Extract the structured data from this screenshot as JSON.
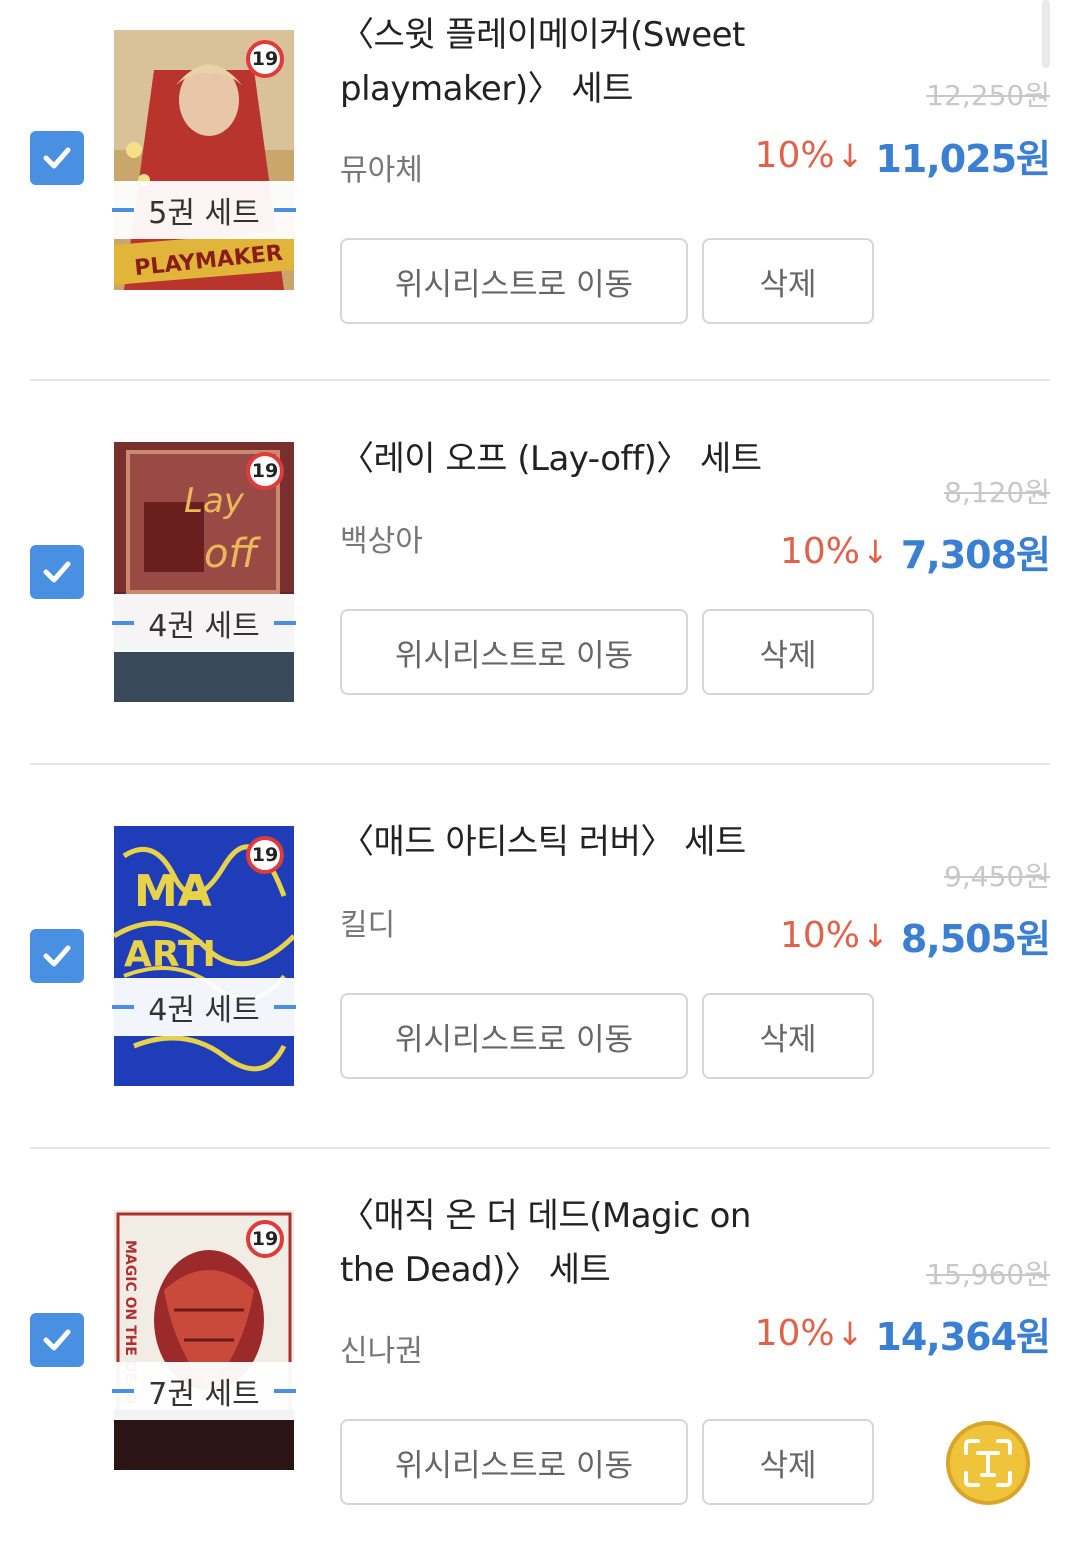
{
  "cart": {
    "items": [
      {
        "title": "〈스윗 플레이메이커(Sweet playmaker)〉 세트",
        "author": "뮤아체",
        "set_count": "5권 세트",
        "age_rating": "19",
        "original_price": "12,250원",
        "discount": "10%",
        "sale_price": "11,025원",
        "checked": true,
        "wishlist_button": "위시리스트로 이동",
        "delete_button": "삭제"
      },
      {
        "title": "〈레이 오프 (Lay-off)〉 세트",
        "author": "백상아",
        "set_count": "4권 세트",
        "age_rating": "19",
        "original_price": "8,120원",
        "discount": "10%",
        "sale_price": "7,308원",
        "checked": true,
        "wishlist_button": "위시리스트로 이동",
        "delete_button": "삭제"
      },
      {
        "title": "〈매드 아티스틱 러버〉 세트",
        "author": "킬디",
        "set_count": "4권 세트",
        "age_rating": "19",
        "original_price": "9,450원",
        "discount": "10%",
        "sale_price": "8,505원",
        "checked": true,
        "wishlist_button": "위시리스트로 이동",
        "delete_button": "삭제"
      },
      {
        "title": "〈매직 온 더 데드(Magic on the Dead)〉 세트",
        "author": "신나권",
        "set_count": "7권 세트",
        "age_rating": "19",
        "original_price": "15,960원",
        "discount": "10%",
        "sale_price": "14,364원",
        "checked": true,
        "wishlist_button": "위시리스트로 이동",
        "delete_button": "삭제"
      }
    ]
  },
  "colors": {
    "checkbox": "#4a90e2",
    "discount": "#e0624a",
    "sale_price": "#3a7fd1",
    "original_price": "#c8c8c8"
  },
  "icons": {
    "checkbox": "checkmark-icon",
    "discount_arrow": "down-arrow-icon",
    "floating_button": "text-scan-icon"
  }
}
